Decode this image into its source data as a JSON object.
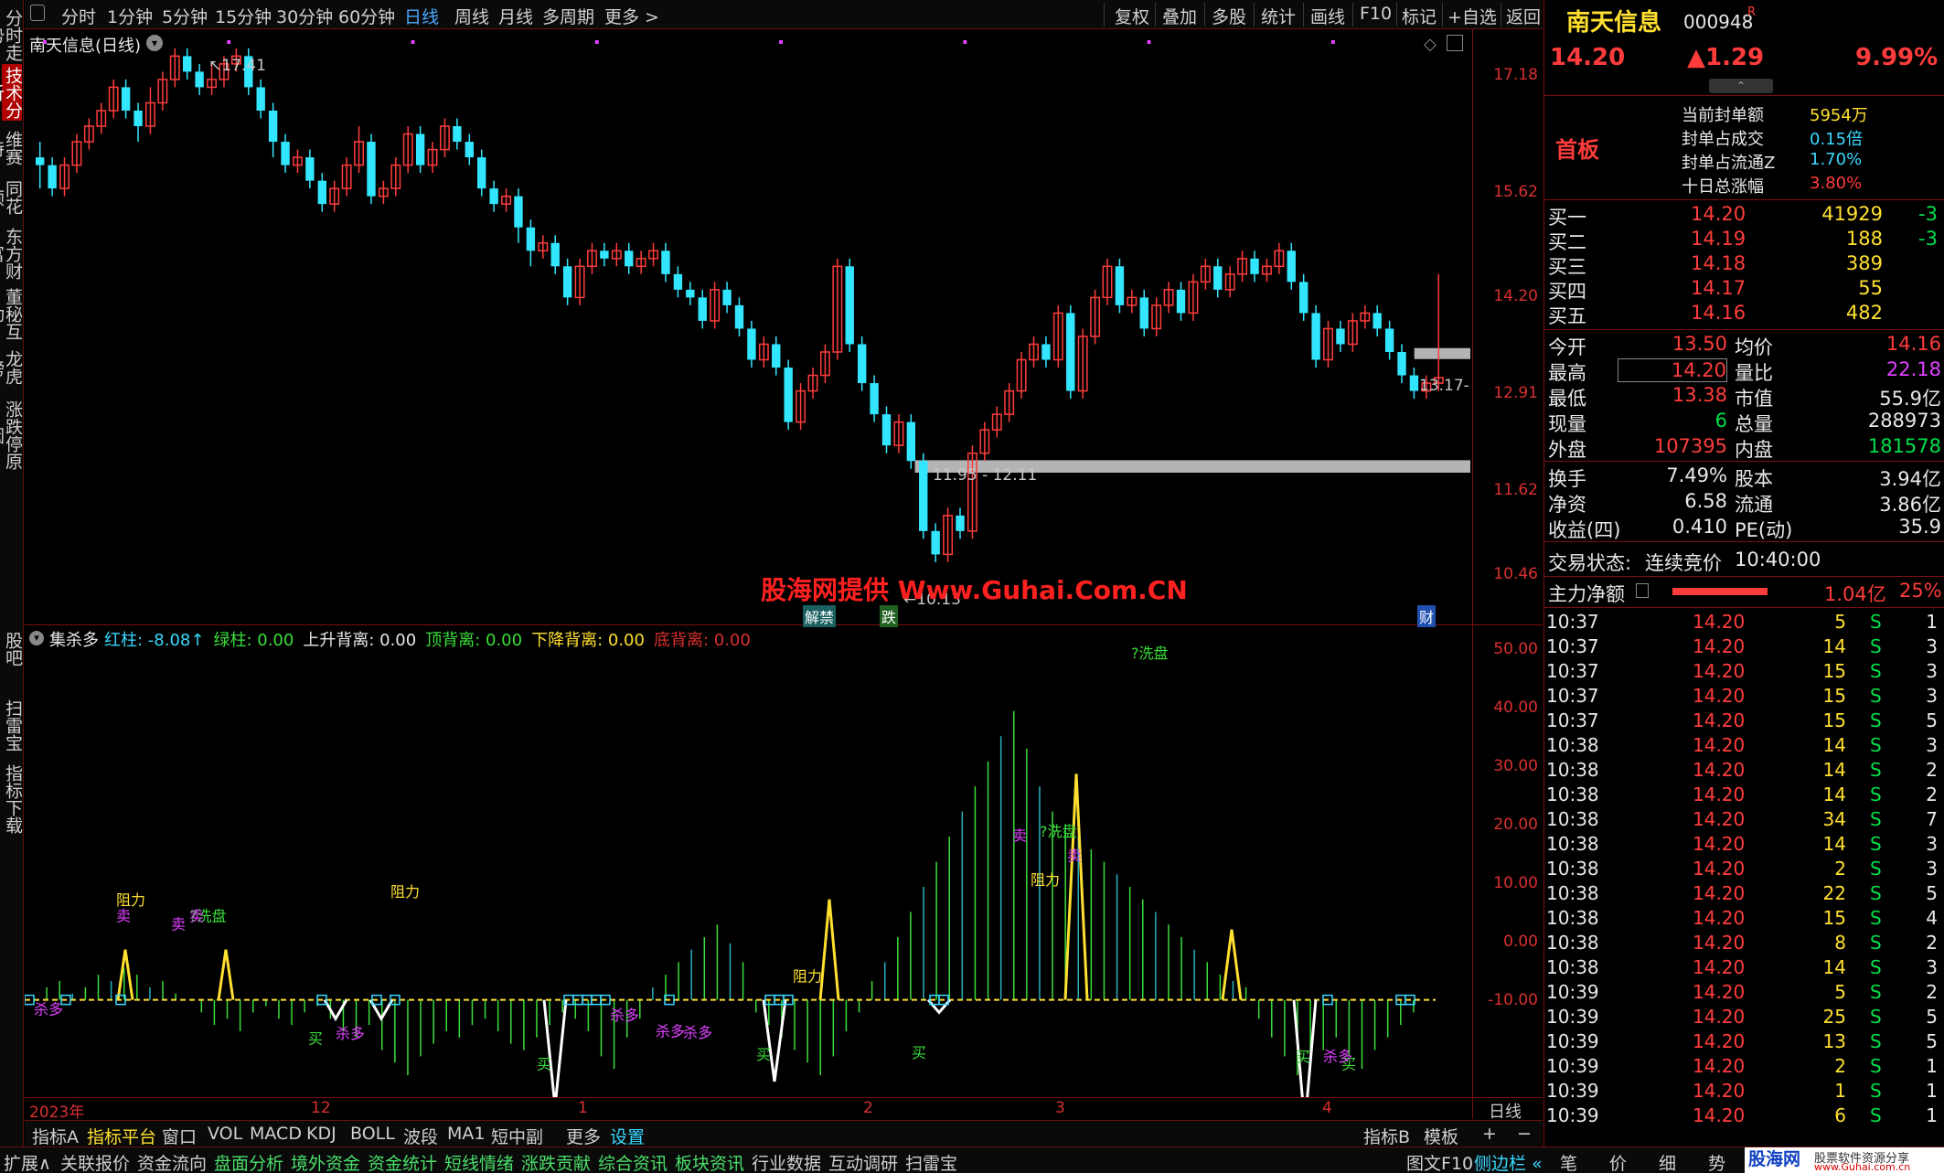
{
  "left_tabs": [
    "分时走势",
    "技术分析",
    "维赛特",
    "同花顺",
    "东方财富",
    "董秘互动",
    "龙虎榜",
    "涨跌停原因",
    "股吧",
    "扫雷宝",
    "指标下载"
  ],
  "top_menu": [
    "分时",
    "1分钟",
    "5分钟",
    "15分钟",
    "30分钟",
    "60分钟",
    "日线",
    "周线",
    "月线",
    "多周期",
    "更多 >"
  ],
  "top_tools": [
    "复权",
    "叠加",
    "多股",
    "统计",
    "画线",
    "F10",
    "标记",
    "+自选",
    "返回"
  ],
  "main_chart": {
    "title": "南天信息(日线)",
    "y_labels": [
      "17.18",
      "15.62",
      "14.20",
      "12.91",
      "11.62",
      "10.46"
    ],
    "high_label": "17.41",
    "low_label": "10.13",
    "last_label": "13.17",
    "zone_label": "11.95 - 12.11",
    "watermark": "股海网提供 Www.Guhai.Com.CN",
    "markers": [
      "解禁",
      "跌",
      "财"
    ],
    "colors": {
      "up": "#ff3c3c",
      "down": "#33e6ff",
      "zone": "#b4b4b4",
      "watermark": "#ff2020"
    }
  },
  "indicator": {
    "name": "集杀多",
    "params": [
      {
        "label": "红柱:",
        "value": "-8.08↑",
        "color": "#3ad8ff"
      },
      {
        "label": "绿柱:",
        "value": "0.00",
        "color": "#3adf3a"
      },
      {
        "label": "上升背离:",
        "value": "0.00",
        "color": "#e8e8e8"
      },
      {
        "label": "顶背离:",
        "value": "0.00",
        "color": "#3adf3a"
      },
      {
        "label": "下降背离:",
        "value": "0.00",
        "color": "#ffe030"
      },
      {
        "label": "底背离:",
        "value": "0.00",
        "color": "#d93030"
      }
    ],
    "y_labels": [
      "50.00",
      "40.00",
      "30.00",
      "20.00",
      "10.00",
      "0.00",
      "-10.00"
    ],
    "annotations": [
      "阻力",
      "卖",
      "?洗盘",
      "卖",
      "阻力",
      "卖",
      "阻力",
      "阻力",
      "?洗盘",
      "卖",
      "卖",
      "?洗盘",
      "买",
      "买",
      "买",
      "买",
      "买",
      "买",
      "杀多",
      "杀多",
      "杀多",
      "杀多",
      "杀多",
      "杀多"
    ]
  },
  "x_axis": {
    "labels": [
      "2023年",
      "12",
      "1",
      "2",
      "3",
      "4"
    ],
    "period": "日线"
  },
  "chart_data": [
    {
      "type": "candlestick",
      "title": "南天信息(日线)",
      "ylim": [
        10.13,
        17.41
      ],
      "y_ticks": [
        17.18,
        15.62,
        14.2,
        12.91,
        11.62,
        10.46
      ],
      "x_labels": [
        "2023年",
        "12",
        "1",
        "2",
        "3",
        "4"
      ],
      "candles": [
        [
          16.0,
          15.9,
          16.2,
          15.6
        ],
        [
          15.9,
          15.6,
          16.0,
          15.5
        ],
        [
          15.6,
          15.9,
          16.0,
          15.5
        ],
        [
          15.9,
          16.2,
          16.3,
          15.8
        ],
        [
          16.2,
          16.4,
          16.5,
          16.1
        ],
        [
          16.4,
          16.6,
          16.7,
          16.3
        ],
        [
          16.6,
          16.9,
          17.0,
          16.5
        ],
        [
          16.9,
          16.6,
          17.0,
          16.5
        ],
        [
          16.6,
          16.4,
          16.7,
          16.2
        ],
        [
          16.4,
          16.7,
          16.9,
          16.3
        ],
        [
          16.7,
          17.0,
          17.1,
          16.6
        ],
        [
          17.0,
          17.3,
          17.4,
          16.9
        ],
        [
          17.3,
          17.1,
          17.4,
          17.0
        ],
        [
          17.1,
          16.9,
          17.2,
          16.8
        ],
        [
          16.9,
          17.0,
          17.2,
          16.8
        ],
        [
          17.0,
          17.2,
          17.3,
          16.9
        ],
        [
          17.2,
          17.3,
          17.4,
          17.1
        ],
        [
          17.3,
          16.9,
          17.4,
          16.8
        ],
        [
          16.9,
          16.6,
          17.0,
          16.5
        ],
        [
          16.6,
          16.2,
          16.7,
          16.0
        ],
        [
          16.2,
          15.9,
          16.3,
          15.8
        ],
        [
          15.9,
          16.0,
          16.1,
          15.8
        ],
        [
          16.0,
          15.7,
          16.1,
          15.6
        ],
        [
          15.7,
          15.4,
          15.8,
          15.3
        ],
        [
          15.4,
          15.6,
          15.7,
          15.3
        ],
        [
          15.6,
          15.9,
          16.0,
          15.5
        ],
        [
          15.9,
          16.2,
          16.4,
          15.8
        ],
        [
          16.2,
          15.5,
          16.3,
          15.4
        ],
        [
          15.5,
          15.6,
          15.7,
          15.4
        ],
        [
          15.6,
          15.9,
          16.0,
          15.5
        ],
        [
          15.9,
          16.3,
          16.4,
          15.8
        ],
        [
          16.3,
          15.9,
          16.4,
          15.8
        ],
        [
          15.9,
          16.1,
          16.2,
          15.8
        ],
        [
          16.1,
          16.4,
          16.5,
          16.0
        ],
        [
          16.4,
          16.2,
          16.5,
          16.1
        ],
        [
          16.2,
          16.0,
          16.3,
          15.9
        ],
        [
          16.0,
          15.6,
          16.1,
          15.5
        ],
        [
          15.6,
          15.4,
          15.7,
          15.3
        ],
        [
          15.4,
          15.5,
          15.6,
          15.3
        ],
        [
          15.5,
          15.1,
          15.6,
          14.9
        ],
        [
          15.1,
          14.8,
          15.2,
          14.6
        ],
        [
          14.8,
          14.9,
          15.0,
          14.7
        ],
        [
          14.9,
          14.6,
          15.0,
          14.5
        ],
        [
          14.6,
          14.2,
          14.7,
          14.1
        ],
        [
          14.2,
          14.6,
          14.7,
          14.1
        ],
        [
          14.6,
          14.8,
          14.9,
          14.5
        ],
        [
          14.8,
          14.7,
          14.9,
          14.6
        ],
        [
          14.7,
          14.8,
          14.9,
          14.6
        ],
        [
          14.8,
          14.6,
          14.9,
          14.5
        ],
        [
          14.6,
          14.7,
          14.8,
          14.5
        ],
        [
          14.7,
          14.8,
          14.9,
          14.6
        ],
        [
          14.8,
          14.5,
          14.9,
          14.4
        ],
        [
          14.5,
          14.3,
          14.6,
          14.2
        ],
        [
          14.3,
          14.2,
          14.4,
          14.1
        ],
        [
          14.2,
          13.9,
          14.3,
          13.8
        ],
        [
          13.9,
          14.3,
          14.4,
          13.8
        ],
        [
          14.3,
          14.1,
          14.4,
          14.0
        ],
        [
          14.1,
          13.8,
          14.2,
          13.7
        ],
        [
          13.8,
          13.4,
          13.9,
          13.3
        ],
        [
          13.4,
          13.6,
          13.7,
          13.3
        ],
        [
          13.6,
          13.3,
          13.7,
          13.2
        ],
        [
          13.3,
          12.6,
          13.4,
          12.5
        ],
        [
          12.6,
          13.0,
          13.1,
          12.5
        ],
        [
          13.0,
          13.2,
          13.3,
          12.9
        ],
        [
          13.2,
          13.5,
          13.6,
          13.1
        ],
        [
          13.5,
          14.6,
          14.7,
          13.4
        ],
        [
          14.6,
          13.6,
          14.7,
          13.5
        ],
        [
          13.6,
          13.1,
          13.7,
          13.0
        ],
        [
          13.1,
          12.7,
          13.2,
          12.6
        ],
        [
          12.7,
          12.3,
          12.8,
          12.2
        ],
        [
          12.3,
          12.6,
          12.7,
          12.2
        ],
        [
          12.6,
          12.1,
          12.7,
          12.0
        ],
        [
          12.1,
          11.2,
          12.2,
          11.1
        ],
        [
          11.2,
          10.9,
          11.3,
          10.8
        ],
        [
          10.9,
          11.4,
          11.5,
          10.8
        ],
        [
          11.4,
          11.2,
          11.5,
          11.1
        ],
        [
          11.2,
          12.2,
          12.3,
          11.1
        ],
        [
          12.2,
          12.5,
          12.6,
          12.1
        ],
        [
          12.5,
          12.7,
          12.8,
          12.4
        ],
        [
          12.7,
          13.0,
          13.1,
          12.6
        ],
        [
          13.0,
          13.4,
          13.5,
          12.9
        ],
        [
          13.4,
          13.6,
          13.7,
          13.3
        ],
        [
          13.6,
          13.4,
          13.7,
          13.3
        ],
        [
          13.4,
          14.0,
          14.1,
          13.3
        ],
        [
          14.0,
          13.0,
          14.1,
          12.9
        ],
        [
          13.0,
          13.7,
          13.8,
          12.9
        ],
        [
          13.7,
          14.2,
          14.3,
          13.6
        ],
        [
          14.2,
          14.6,
          14.7,
          14.1
        ],
        [
          14.6,
          14.1,
          14.7,
          14.0
        ],
        [
          14.1,
          14.2,
          14.3,
          14.0
        ],
        [
          14.2,
          13.8,
          14.3,
          13.7
        ],
        [
          13.8,
          14.1,
          14.2,
          13.7
        ],
        [
          14.1,
          14.3,
          14.4,
          14.0
        ],
        [
          14.3,
          14.0,
          14.4,
          13.9
        ],
        [
          14.0,
          14.4,
          14.5,
          13.9
        ],
        [
          14.4,
          14.6,
          14.7,
          14.3
        ],
        [
          14.6,
          14.3,
          14.7,
          14.2
        ],
        [
          14.3,
          14.5,
          14.6,
          14.2
        ],
        [
          14.5,
          14.7,
          14.8,
          14.4
        ],
        [
          14.7,
          14.5,
          14.8,
          14.4
        ],
        [
          14.5,
          14.6,
          14.7,
          14.4
        ],
        [
          14.6,
          14.8,
          14.9,
          14.5
        ],
        [
          14.8,
          14.4,
          14.9,
          14.3
        ],
        [
          14.4,
          14.0,
          14.5,
          13.9
        ],
        [
          14.0,
          13.4,
          14.1,
          13.3
        ],
        [
          13.4,
          13.8,
          13.9,
          13.3
        ],
        [
          13.8,
          13.6,
          13.9,
          13.5
        ],
        [
          13.6,
          13.9,
          14.0,
          13.5
        ],
        [
          13.9,
          14.0,
          14.1,
          13.8
        ],
        [
          14.0,
          13.8,
          14.1,
          13.7
        ],
        [
          13.8,
          13.5,
          13.9,
          13.4
        ],
        [
          13.5,
          13.2,
          13.6,
          13.1
        ],
        [
          13.2,
          13.0,
          13.3,
          12.9
        ],
        [
          13.0,
          13.1,
          13.2,
          12.9
        ],
        [
          13.1,
          13.17,
          14.5,
          13.0
        ]
      ]
    },
    {
      "type": "bar",
      "title": "集杀多",
      "ylim": [
        -12,
        55
      ],
      "y_ticks": [
        50,
        40,
        30,
        20,
        10,
        0,
        -10
      ],
      "values": [
        0,
        2,
        3,
        1,
        2,
        4,
        3,
        5,
        4,
        2,
        3,
        1,
        0,
        -2,
        -4,
        -3,
        -5,
        -2,
        -1,
        -3,
        -4,
        -2,
        -1,
        -3,
        -5,
        -6,
        -4,
        -8,
        -10,
        -12,
        -9,
        -7,
        -5,
        -6,
        -4,
        -3,
        -5,
        -7,
        -8,
        -6,
        -4,
        -2,
        -3,
        -5,
        -9,
        -11,
        -6,
        -3,
        2,
        4,
        6,
        8,
        10,
        12,
        9,
        6,
        -2,
        -4,
        -6,
        -8,
        -10,
        -12,
        -9,
        -5,
        -2,
        3,
        6,
        10,
        14,
        18,
        22,
        26,
        30,
        34,
        38,
        42,
        46,
        40,
        34,
        30,
        28,
        26,
        24,
        22,
        20,
        18,
        16,
        14,
        12,
        10,
        8,
        6,
        4,
        3,
        2,
        -3,
        -6,
        -9,
        -12,
        -10,
        -8,
        -6,
        -9,
        -11,
        -8,
        -6,
        -4,
        -2
      ]
    }
  ],
  "right_panel": {
    "name": "南天信息",
    "code": "000948",
    "r": "R",
    "price": "14.20",
    "change": "▲1.29",
    "pct": "9.99%",
    "board": "首板",
    "seal": [
      {
        "label": "当前封单额",
        "value": "5954万"
      },
      {
        "label": "封单占成交",
        "value": "0.15倍"
      },
      {
        "label": "封单占流通Z",
        "value": "1.70%"
      },
      {
        "label": "十日总涨幅",
        "value": "3.80%"
      }
    ],
    "bids": [
      {
        "label": "买一",
        "price": "14.20",
        "vol": "41929",
        "chg": "-3"
      },
      {
        "label": "买二",
        "price": "14.19",
        "vol": "188",
        "chg": "-3"
      },
      {
        "label": "买三",
        "price": "14.18",
        "vol": "389",
        "chg": ""
      },
      {
        "label": "买四",
        "price": "14.17",
        "vol": "55",
        "chg": ""
      },
      {
        "label": "买五",
        "price": "14.16",
        "vol": "482",
        "chg": ""
      }
    ],
    "stats": [
      {
        "l1": "今开",
        "v1": "13.50",
        "l2": "均价",
        "v2": "14.16"
      },
      {
        "l1": "最高",
        "v1": "14.20",
        "l2": "量比",
        "v2": "22.18"
      },
      {
        "l1": "最低",
        "v1": "13.38",
        "l2": "市值",
        "v2": "55.9亿"
      },
      {
        "l1": "现量",
        "v1": "6",
        "l2": "总量",
        "v2": "288973"
      },
      {
        "l1": "外盘",
        "v1": "107395",
        "l2": "内盘",
        "v2": "181578"
      }
    ],
    "stats2": [
      {
        "l1": "换手",
        "v1": "7.49%",
        "l2": "股本",
        "v2": "3.94亿"
      },
      {
        "l1": "净资",
        "v1": "6.58",
        "l2": "流通",
        "v2": "3.86亿"
      },
      {
        "l1": "收益(四)",
        "v1": "0.410",
        "l2": "PE(动)",
        "v2": "35.9"
      }
    ],
    "status_label": "交易状态:",
    "status_value": "连续竞价",
    "status_time": "10:40:00",
    "flow_label": "主力净额",
    "flow_value": "1.04亿",
    "flow_pct": "25%",
    "ticks": [
      [
        "10:37",
        "14.20",
        "5",
        "S",
        "1"
      ],
      [
        "10:37",
        "14.20",
        "14",
        "S",
        "3"
      ],
      [
        "10:37",
        "14.20",
        "15",
        "S",
        "3"
      ],
      [
        "10:37",
        "14.20",
        "15",
        "S",
        "3"
      ],
      [
        "10:37",
        "14.20",
        "15",
        "S",
        "5"
      ],
      [
        "10:38",
        "14.20",
        "14",
        "S",
        "3"
      ],
      [
        "10:38",
        "14.20",
        "14",
        "S",
        "2"
      ],
      [
        "10:38",
        "14.20",
        "14",
        "S",
        "2"
      ],
      [
        "10:38",
        "14.20",
        "34",
        "S",
        "7"
      ],
      [
        "10:38",
        "14.20",
        "14",
        "S",
        "3"
      ],
      [
        "10:38",
        "14.20",
        "2",
        "S",
        "3"
      ],
      [
        "10:38",
        "14.20",
        "22",
        "S",
        "5"
      ],
      [
        "10:38",
        "14.20",
        "15",
        "S",
        "4"
      ],
      [
        "10:38",
        "14.20",
        "8",
        "S",
        "2"
      ],
      [
        "10:38",
        "14.20",
        "14",
        "S",
        "3"
      ],
      [
        "10:39",
        "14.20",
        "5",
        "S",
        "2"
      ],
      [
        "10:39",
        "14.20",
        "25",
        "S",
        "5"
      ],
      [
        "10:39",
        "14.20",
        "13",
        "S",
        "5"
      ],
      [
        "10:39",
        "14.20",
        "2",
        "S",
        "1"
      ],
      [
        "10:39",
        "14.20",
        "1",
        "S",
        "1"
      ],
      [
        "10:39",
        "14.20",
        "6",
        "S",
        "1"
      ]
    ],
    "bottom_tabs": [
      "笔",
      "价",
      "细",
      "势"
    ]
  },
  "bottom_bar1": [
    "指标A",
    "指标平台",
    "窗口",
    "VOL",
    "MACD",
    "KDJ",
    "BOLL",
    "波段",
    "MA1",
    "短中副",
    "更多",
    "设置",
    "指标B",
    "模板",
    "+",
    "−"
  ],
  "bottom_bar2": [
    "扩展∧",
    "关联报价",
    "资金流向",
    "盘面分析",
    "境外资金",
    "资金统计",
    "短线情绪",
    "涨跌贡献",
    "综合资讯",
    "板块资讯",
    "行业数据",
    "互动调研",
    "扫雷宝",
    "图文F10",
    "侧边栏 «"
  ],
  "footer_logo": {
    "name": "股海网",
    "slogan": "股票软件资源分享",
    "url": "www.Guhai.com.cn"
  }
}
